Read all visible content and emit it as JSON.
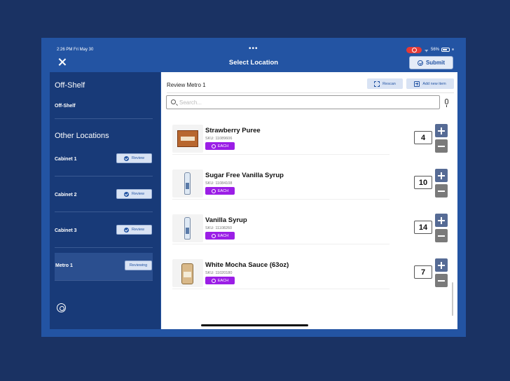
{
  "status": {
    "time": "2:26 PM  Fri May 30",
    "dots": "•••",
    "battery": "56%"
  },
  "header": {
    "title": "Select Location",
    "submit_label": "Submit"
  },
  "sidebar": {
    "heading_offshelf": "Off-Shelf",
    "heading_other": "Other Locations",
    "items": [
      {
        "label": "Off-Shelf"
      },
      {
        "label": "Cabinet 1",
        "button": "Review"
      },
      {
        "label": "Cabinet 2",
        "button": "Review"
      },
      {
        "label": "Cabinet 3",
        "button": "Review"
      },
      {
        "label": "Metro 1",
        "button": "Reviewing"
      }
    ]
  },
  "main": {
    "title": "Review Metro 1",
    "rescan_label": "Rescan",
    "add_new_label": "Add new item",
    "search_placeholder": "Search..."
  },
  "products": [
    {
      "name": "Strawberry Puree",
      "sku": "SKU: 11089606",
      "unit": "EACH",
      "qty": "4",
      "image": "box"
    },
    {
      "name": "Sugar Free Vanilla Syrup",
      "sku": "SKU: 11084108",
      "unit": "EACH",
      "qty": "10",
      "image": "bottle"
    },
    {
      "name": "Vanilla Syrup",
      "sku": "SKU: 11108260",
      "unit": "EACH",
      "qty": "14",
      "image": "bottle"
    },
    {
      "name": "White Mocha Sauce (63oz)",
      "sku": "SKU: 11020180",
      "unit": "EACH",
      "qty": "7",
      "image": "jar"
    }
  ],
  "colors": {
    "background": "#1a3263",
    "device": "#2354a3",
    "sidebar": "#183a78",
    "unit_badge": "#9b1ee6",
    "plus": "#566b95",
    "minus": "#7a7a7a"
  }
}
